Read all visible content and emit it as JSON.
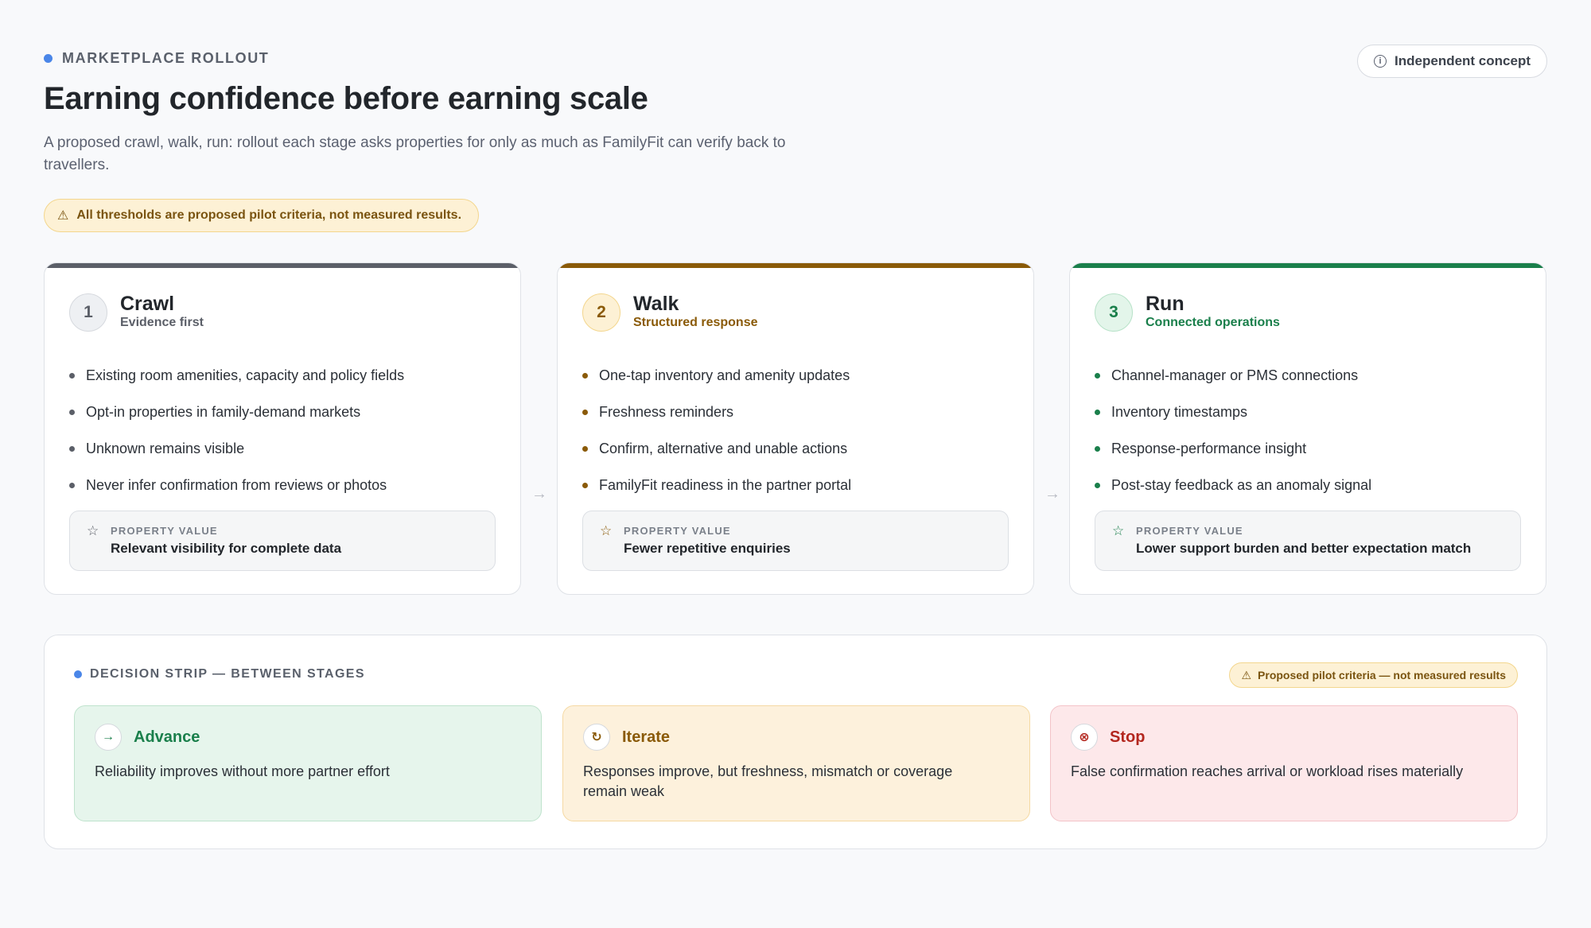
{
  "header": {
    "eyebrow": "MARKETPLACE ROLLOUT",
    "title": "Earning confidence before earning scale",
    "subtitle": "A proposed crawl, walk, run: rollout each stage asks properties for only as much as FamilyFit can verify back to travellers.",
    "concept_pill": "Independent concept",
    "warning": "All thresholds are proposed pilot criteria, not measured results."
  },
  "stages": [
    {
      "number": "1",
      "name": "Crawl",
      "tag": "Evidence first",
      "accent": "#5b5f68",
      "items": [
        "Existing room amenities, capacity and policy fields",
        "Opt-in properties in family-demand markets",
        "Unknown remains visible",
        "Never infer confirmation from reviews or photos"
      ],
      "value_label": "PROPERTY VALUE",
      "value_text": "Relevant visibility for complete data"
    },
    {
      "number": "2",
      "name": "Walk",
      "tag": "Structured response",
      "accent": "#8a5a08",
      "items": [
        "One-tap inventory and amenity updates",
        "Freshness reminders",
        "Confirm, alternative and unable actions",
        "FamilyFit readiness in the partner portal"
      ],
      "value_label": "PROPERTY VALUE",
      "value_text": "Fewer repetitive enquiries"
    },
    {
      "number": "3",
      "name": "Run",
      "tag": "Connected operations",
      "accent": "#1a7f4b",
      "items": [
        "Channel-manager or PMS connections",
        "Inventory timestamps",
        "Response-performance insight",
        "Post-stay feedback as an anomaly signal"
      ],
      "value_label": "PROPERTY VALUE",
      "value_text": "Lower support burden and better expectation match"
    }
  ],
  "decision_strip": {
    "heading": "DECISION STRIP — BETWEEN STAGES",
    "pill": "Proposed pilot criteria — not measured results",
    "decisions": [
      {
        "title": "Advance",
        "icon": "arrow-right-icon",
        "text": "Reliability improves without more partner effort"
      },
      {
        "title": "Iterate",
        "icon": "refresh-icon",
        "text": "Responses improve, but freshness, mismatch or coverage remain weak"
      },
      {
        "title": "Stop",
        "icon": "stop-icon",
        "text": "False confirmation reaches arrival or workload rises materially"
      }
    ]
  }
}
